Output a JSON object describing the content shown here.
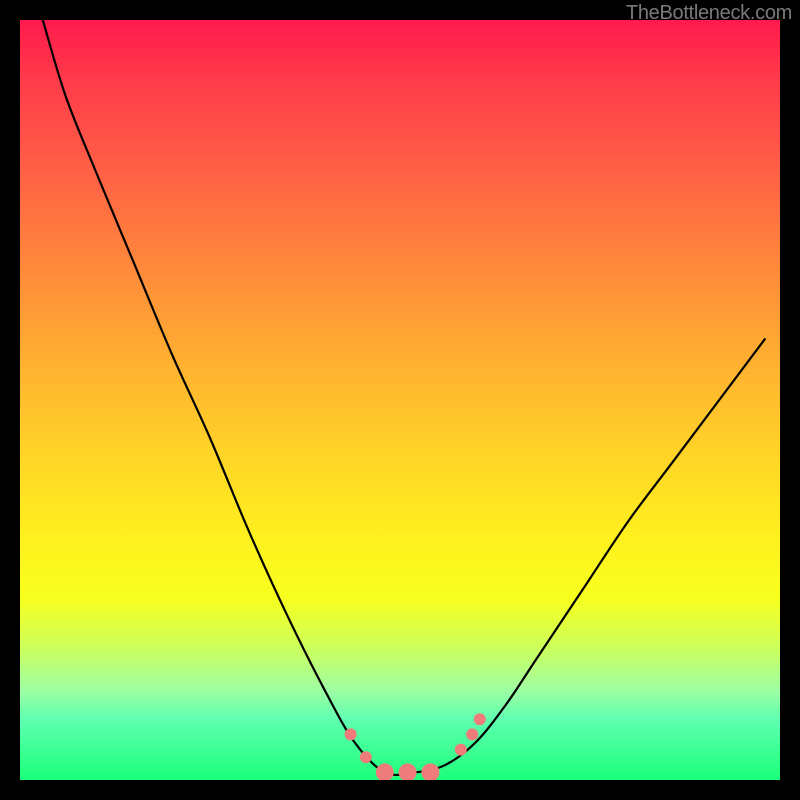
{
  "watermark": "TheBottleneck.com",
  "chart_data": {
    "type": "line",
    "title": "",
    "xlabel": "",
    "ylabel": "",
    "xlim": [
      0,
      10
    ],
    "ylim": [
      0,
      100
    ],
    "grid": false,
    "series": [
      {
        "name": "bottleneck-curve",
        "x": [
          0.3,
          0.6,
          1.0,
          1.5,
          2.0,
          2.5,
          3.0,
          3.5,
          4.0,
          4.4,
          4.8,
          5.2,
          5.6,
          6.0,
          6.4,
          6.8,
          7.4,
          8.0,
          8.6,
          9.2,
          9.8
        ],
        "y": [
          100,
          90,
          80,
          68,
          56,
          45,
          33,
          22,
          12,
          5,
          1,
          1,
          2,
          5,
          10,
          16,
          25,
          34,
          42,
          50,
          58
        ]
      }
    ],
    "markers": {
      "name": "highlight-points",
      "color": "#ef7b7b",
      "radius_small": 6,
      "radius_large": 9,
      "points": [
        {
          "x": 4.35,
          "y": 6,
          "r": "small"
        },
        {
          "x": 4.55,
          "y": 3,
          "r": "small"
        },
        {
          "x": 4.8,
          "y": 1,
          "r": "large"
        },
        {
          "x": 5.1,
          "y": 1,
          "r": "large"
        },
        {
          "x": 5.4,
          "y": 1,
          "r": "large"
        },
        {
          "x": 5.8,
          "y": 4,
          "r": "small"
        },
        {
          "x": 5.95,
          "y": 6,
          "r": "small"
        },
        {
          "x": 6.05,
          "y": 8,
          "r": "small"
        }
      ]
    }
  }
}
